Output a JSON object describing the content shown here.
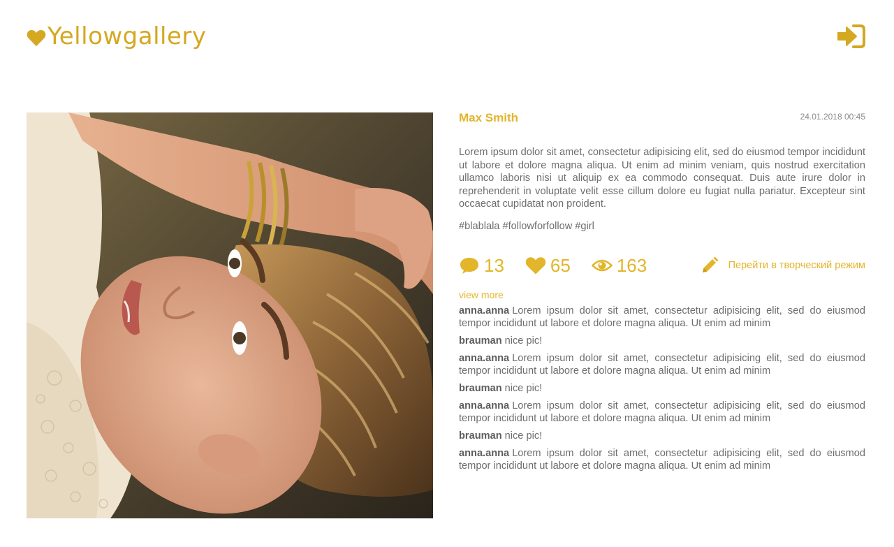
{
  "header": {
    "logo_text": "Yellowgallery",
    "login_icon": "sign-in-icon"
  },
  "colors": {
    "accent": "#e3b52a",
    "logo": "#d4a820",
    "text": "#6d6d6d"
  },
  "post": {
    "image_icon": "photo",
    "author": "Max Smith",
    "date": "24.01.2018 00:45",
    "description": "Lorem ipsum dolor sit amet, consectetur adipisicing elit, sed do eiusmod tempor incididunt ut labore et dolore magna aliqua. Ut enim ad minim veniam, quis nostrud exercitation ullamco laboris nisi ut aliquip ex ea commodo consequat. Duis aute irure dolor in reprehenderit in voluptate velit esse cillum dolore eu fugiat nulla pariatur. Excepteur sint occaecat cupidatat non proident.",
    "tags": "#blablala #followforfollow #girl",
    "stats": {
      "comments": "13",
      "likes": "65",
      "views": "163"
    },
    "creative_mode_label": "Перейти в творческий режим",
    "view_more_label": "view more"
  },
  "comments": [
    {
      "user": "anna.anna",
      "text": "Lorem ipsum dolor sit amet, consectetur adipisicing elit, sed do eiusmod tempor incididunt ut labore et dolore magna aliqua. Ut enim ad minim"
    },
    {
      "user": "brauman",
      "text": "nice pic!"
    },
    {
      "user": "anna.anna",
      "text": "Lorem ipsum dolor sit amet, consectetur adipisicing elit, sed do eiusmod tempor incididunt ut labore et dolore magna aliqua. Ut enim ad minim"
    },
    {
      "user": "brauman",
      "text": "nice pic!"
    },
    {
      "user": "anna.anna",
      "text": "Lorem ipsum dolor sit amet, consectetur adipisicing elit, sed do eiusmod tempor incididunt ut labore et dolore magna aliqua. Ut enim ad minim"
    },
    {
      "user": "brauman",
      "text": "nice pic!"
    },
    {
      "user": "anna.anna",
      "text": "Lorem ipsum dolor sit amet, consectetur adipisicing elit, sed do eiusmod tempor incididunt ut labore et dolore magna aliqua. Ut enim ad minim"
    }
  ]
}
